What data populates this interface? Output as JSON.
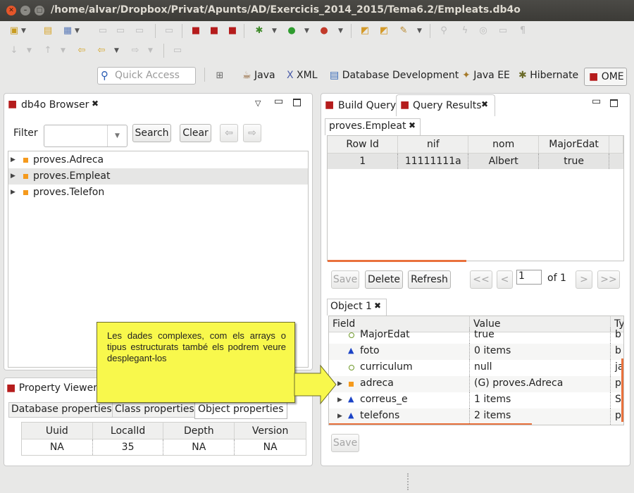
{
  "window": {
    "title": "/home/alvar/Dropbox/Privat/Apunts/AD/Exercicis_2014_2015/Tema6.2/Empleats.db4o"
  },
  "quick_access": {
    "placeholder": "Quick Access"
  },
  "perspectives": [
    "Java",
    "XML",
    "Database Development",
    "Java EE",
    "Hibernate",
    "OME"
  ],
  "browser": {
    "tab_label": "db4o Browser",
    "filter_label": "Filter",
    "search_label": "Search",
    "clear_label": "Clear",
    "classes": [
      "proves.Adreca",
      "proves.Empleat",
      "proves.Telefon"
    ]
  },
  "property_viewer": {
    "tab_label": "Property Viewer",
    "subtabs": [
      "Database properties",
      "Class properties",
      "Object properties"
    ],
    "columns": [
      "Uuid",
      "LocalId",
      "Depth",
      "Version"
    ],
    "row": [
      "NA",
      "35",
      "NA",
      "NA"
    ]
  },
  "query": {
    "tabs": [
      "Build Query",
      "Query Results"
    ],
    "results_tab": "proves.Empleat",
    "columns": [
      "Row Id",
      "nif",
      "nom",
      "MajorEdat"
    ],
    "rows": [
      [
        "1",
        "11111111a",
        "Albert",
        "true"
      ]
    ],
    "save_label": "Save",
    "delete_label": "Delete",
    "refresh_label": "Refresh",
    "page_value": "1",
    "of_label": "of 1",
    "first_label": "<<",
    "prev_label": "<",
    "next_label": ">",
    "last_label": ">>"
  },
  "object": {
    "tab_label": "Object 1",
    "columns": [
      "Field",
      "Value",
      "Ty"
    ],
    "fields": [
      {
        "name": "MajorEdat",
        "value": "true",
        "type": "b",
        "icon": "circle"
      },
      {
        "name": "foto",
        "value": "0 items",
        "type": "b",
        "icon": "triangle"
      },
      {
        "name": "curriculum",
        "value": "null",
        "type": "ja",
        "icon": "circle"
      },
      {
        "name": "adreca",
        "value": "(G) proves.Adreca",
        "type": "p",
        "icon": "square"
      },
      {
        "name": "correus_e",
        "value": "1 items",
        "type": "S",
        "icon": "triangle"
      },
      {
        "name": "telefons",
        "value": "2 items",
        "type": "p",
        "icon": "triangle"
      }
    ],
    "save_label": "Save"
  },
  "callout": {
    "text": "Les dades complexes, com els arrays o tipus estructurats també els podrem veure desplegant-los"
  },
  "colors": {
    "callout": "#f8f84c",
    "accent": "#e9713c",
    "title_bar": "#3c3b37"
  }
}
